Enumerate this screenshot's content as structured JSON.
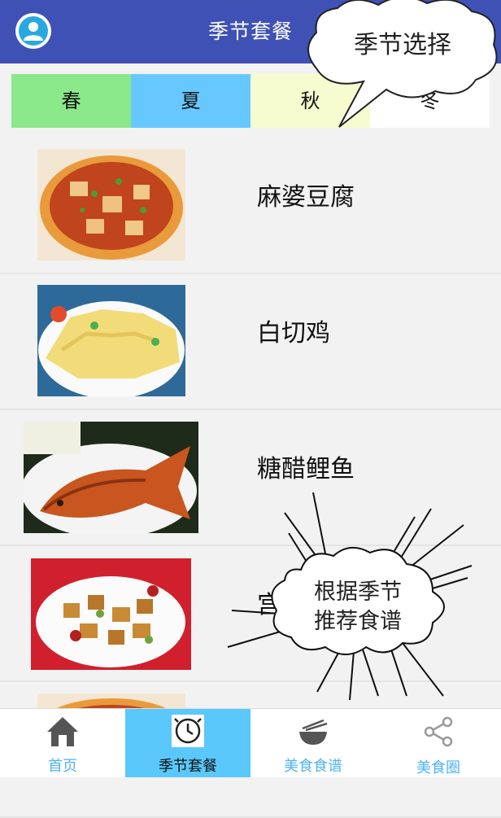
{
  "header": {
    "title": "季节套餐"
  },
  "seasons": [
    {
      "label": "春",
      "color": "#8be88b"
    },
    {
      "label": "夏",
      "color": "#66c8ff"
    },
    {
      "label": "秋",
      "color": "#f7fbd0"
    },
    {
      "label": "冬",
      "color": "#ffffff"
    }
  ],
  "dishes": [
    {
      "name": "麻婆豆腐",
      "icon": "mapo-tofu-photo"
    },
    {
      "name": "白切鸡",
      "icon": "white-cut-chicken-photo"
    },
    {
      "name": "糖醋鲤鱼",
      "icon": "sweet-sour-carp-photo"
    },
    {
      "name": "宫保鸡丁",
      "icon": "kung-pao-chicken-photo"
    },
    {
      "name": "",
      "icon": "dish-photo"
    }
  ],
  "nav": {
    "items": [
      {
        "label": "首页",
        "icon": "home-icon"
      },
      {
        "label": "季节套餐",
        "icon": "clock-icon",
        "active": true
      },
      {
        "label": "美食食谱",
        "icon": "bowl-icon"
      },
      {
        "label": "美食圈",
        "icon": "share-icon"
      }
    ],
    "active_color": "#5ac8fa",
    "label_color": "#4fb3f5"
  },
  "callouts": {
    "season_select": "季节选择",
    "recommend_line1": "根据季节",
    "recommend_line2": "推荐食谱"
  }
}
